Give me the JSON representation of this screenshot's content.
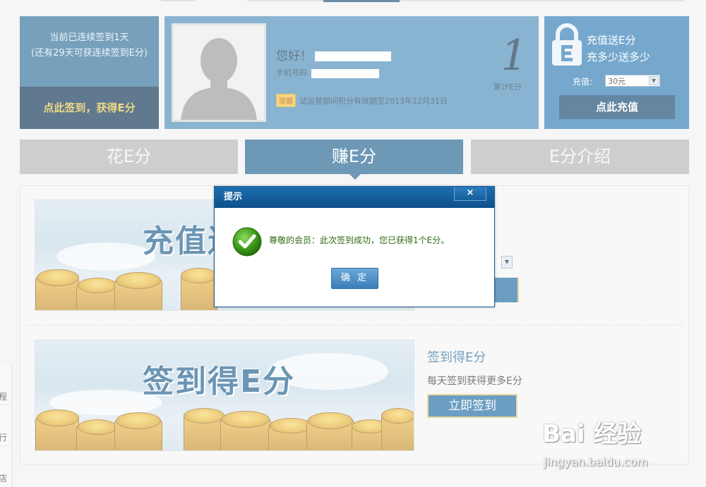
{
  "signin_card": {
    "line1": "当前已连续签到1天",
    "line2": "(还有29天可获连续签到E分)",
    "action": "点此签到，获得E分"
  },
  "profile": {
    "greeting": "您好！",
    "phone_label": "手机号码",
    "tip_badge": "提醒",
    "tip_text": "试运营期间积分有效期至2013年12月31日",
    "points_value": "1",
    "points_label": "累计E分"
  },
  "recharge": {
    "title_line1": "充值送E分",
    "title_line2": "充多少送多少",
    "amount_label": "充值:",
    "amount_selected": "30元",
    "button": "点此充值"
  },
  "tabs": [
    {
      "label": "花E分",
      "active": false
    },
    {
      "label": "赚E分",
      "active": true
    },
    {
      "label": "E分介绍",
      "active": false
    }
  ],
  "promo1": {
    "banner_title": "充值送"
  },
  "promo2": {
    "banner_title": "签到得E分",
    "title": "签到得E分",
    "desc": "每天签到获得更多E分",
    "button": "立即签到"
  },
  "left_sidebar": [
    "程",
    "行",
    "店"
  ],
  "dialog": {
    "title": "提示",
    "close": "×",
    "message": "尊敬的会员：此次签到成功，您已获得1个E分。",
    "ok": "确 定"
  },
  "watermark": {
    "brand": "Bai 经验",
    "url": "jingyan.baidu.com"
  },
  "colors": {
    "accent": "#1f6190",
    "dark": "#0b3252",
    "gold_text": "#e9c246"
  }
}
